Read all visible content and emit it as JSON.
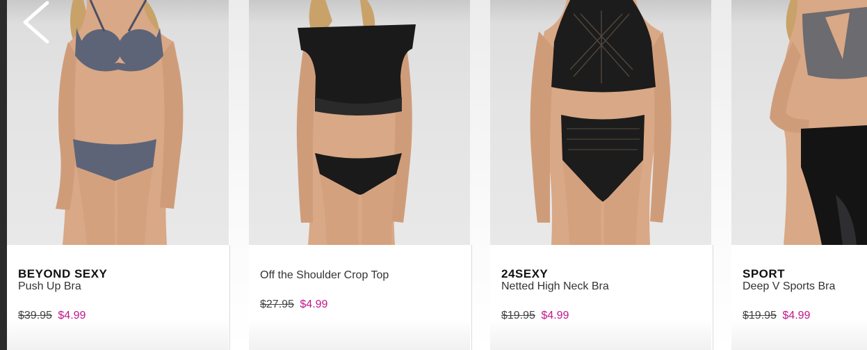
{
  "products": [
    {
      "brand": "BEYOND SEXY",
      "name": "Push Up Bra",
      "old_price": "$39.95",
      "sale_price": "$4.99",
      "garment_color": "#5d6478"
    },
    {
      "brand": "",
      "name": "Off the Shoulder Crop Top",
      "old_price": "$27.95",
      "sale_price": "$4.99",
      "garment_color": "#1a1a1a"
    },
    {
      "brand": "24SEXY",
      "name": "Netted High Neck Bra",
      "old_price": "$19.95",
      "sale_price": "$4.99",
      "garment_color": "#1c1c1c"
    },
    {
      "brand": "SPORT",
      "name": "Deep V Sports Bra",
      "old_price": "$19.95",
      "sale_price": "$4.99",
      "garment_color": "#6b6b70"
    }
  ],
  "colors": {
    "sale_price": "#c2168a",
    "skin": "#d9a886",
    "hair": "#c9a26a"
  },
  "icons": {
    "prev": "chevron-left-icon"
  }
}
